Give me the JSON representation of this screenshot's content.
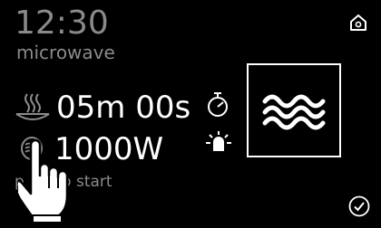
{
  "status": {
    "clock": "12:30",
    "mode": "microwave"
  },
  "settings": {
    "duration": "05m 00s",
    "power": "1000W"
  },
  "hint": "pд ick to start",
  "hint_visible": "p    ick to start",
  "icons": {
    "home": "home-icon",
    "steam": "steam-plate-icon",
    "power": "microwave-power-icon",
    "timer": "stopwatch-icon",
    "light": "light-bulb-icon",
    "program": "microwave-waves-icon",
    "confirm": "checkmark-icon",
    "pointer": "hand-pointer-icon"
  },
  "colors": {
    "background": "#000000",
    "text_dim": "#8a8a8a",
    "text_bright": "#ffffff"
  }
}
